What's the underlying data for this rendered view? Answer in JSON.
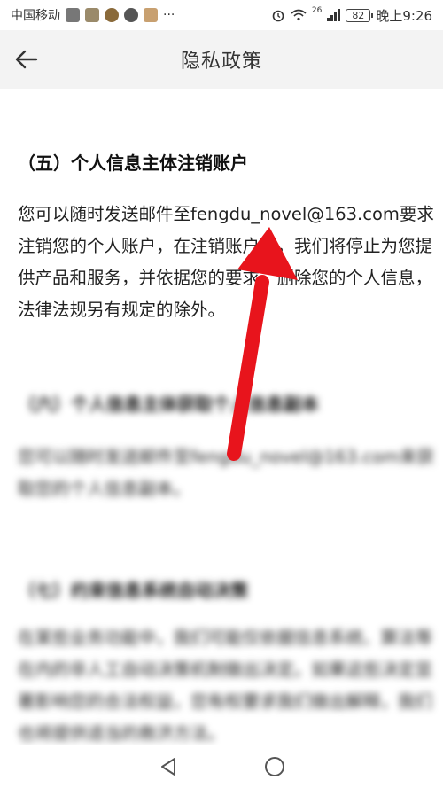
{
  "status_bar": {
    "carrier": "中国移动",
    "more": "···",
    "network": "26",
    "battery": "82",
    "time": "晚上9:26"
  },
  "header": {
    "title": "隐私政策"
  },
  "sections": [
    {
      "heading": "（五）个人信息主体注销账户",
      "body": "您可以随时发送邮件至fengdu_novel@163.com要求注销您的个人账户，在注销账户后，我们将停止为您提供产品和服务，并依据您的要求，删除您的个人信息，法律法规另有规定的除外。"
    },
    {
      "heading": "（六）个人信息主体获取个人信息副本",
      "body": "您可以随时发送邮件至fengdu_novel@163.com来获取您的个人信息副本。"
    },
    {
      "heading": "（七）约束信息系统自动决策",
      "body": "在某些业务功能中，我们可能仅依据信息系统、算法等在内的非人工自动决策机制做出决定。如果这些决定显著影响您的合法权益，您有权要求我们做出解释，我们也将提供适当的救济方法。"
    }
  ],
  "colors": {
    "arrow": "#e8141c",
    "header_bg": "#f3f3f3",
    "bottom_nav_bg": "#ffffff"
  }
}
